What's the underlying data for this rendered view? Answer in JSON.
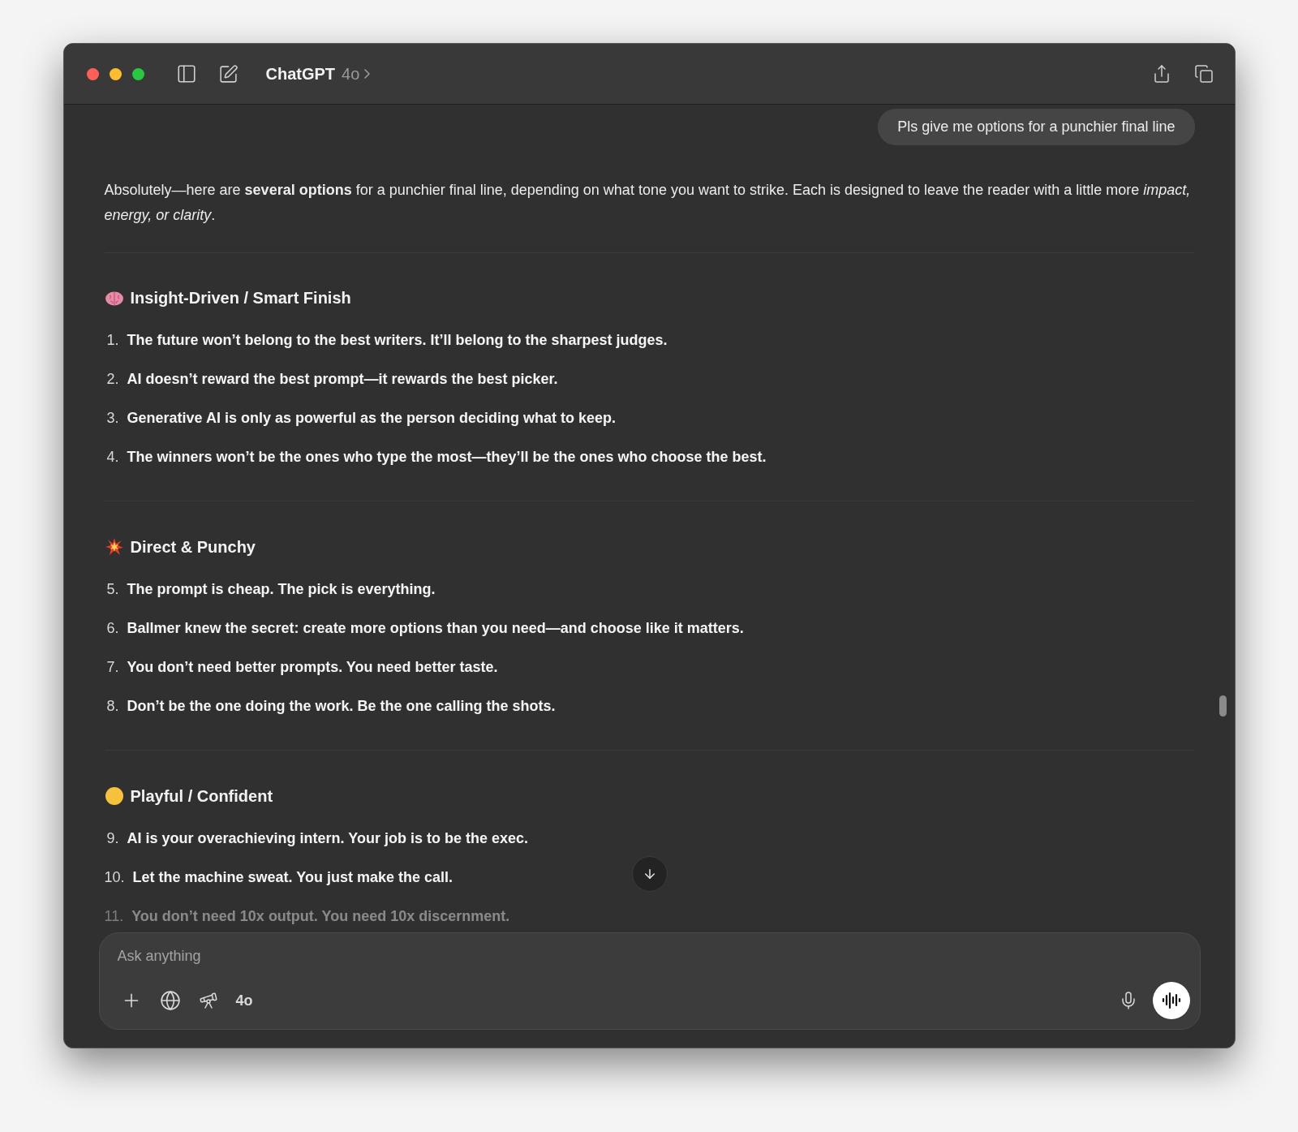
{
  "window": {
    "title": "ChatGPT",
    "model": "4o"
  },
  "user_message": "Pls give me options for a punchier final line",
  "intro": "Absolutely—here are **several options** for a punchier final line, depending on what tone you want to strike. Each is designed to leave the reader with a little more *impact, energy, or clarity*.",
  "sections": [
    {
      "heading": "Insight-Driven / Smart Finish",
      "items": [
        {
          "number": "1.",
          "text": "The future won’t belong to the best writers. It’ll belong to the sharpest judges.",
          "faded": false
        },
        {
          "number": "2.",
          "text": "AI doesn’t reward the best prompt—it rewards the best picker.",
          "faded": false
        },
        {
          "number": "3.",
          "text": "Generative AI is only as powerful as the person deciding what to keep.",
          "faded": false
        },
        {
          "number": "4.",
          "text": "The winners won’t be the ones who type the most—they’ll be the ones who choose the best.",
          "faded": false
        }
      ]
    },
    {
      "heading": "Direct & Punchy",
      "items": [
        {
          "number": "5.",
          "text": "The prompt is cheap. The pick is everything.",
          "faded": false
        },
        {
          "number": "6.",
          "text": "Ballmer knew the secret: create more options than you need—and choose like it matters.",
          "faded": false
        },
        {
          "number": "7.",
          "text": "You don’t need better prompts. You need better taste.",
          "faded": false
        },
        {
          "number": "8.",
          "text": "Don’t be the one doing the work. Be the one calling the shots.",
          "faded": false
        }
      ]
    },
    {
      "heading": "Playful / Confident",
      "items": [
        {
          "number": "9.",
          "text": "AI is your overachieving intern. Your job is to be the exec.",
          "faded": false
        },
        {
          "number": "10.",
          "text": "Let the machine sweat. You just make the call.",
          "faded": false
        },
        {
          "number": "11.",
          "text": "You don’t need 10x output. You need 10x discernment.",
          "faded": true
        }
      ]
    }
  ],
  "composer": {
    "placeholder": "Ask anything",
    "model": "4o"
  }
}
